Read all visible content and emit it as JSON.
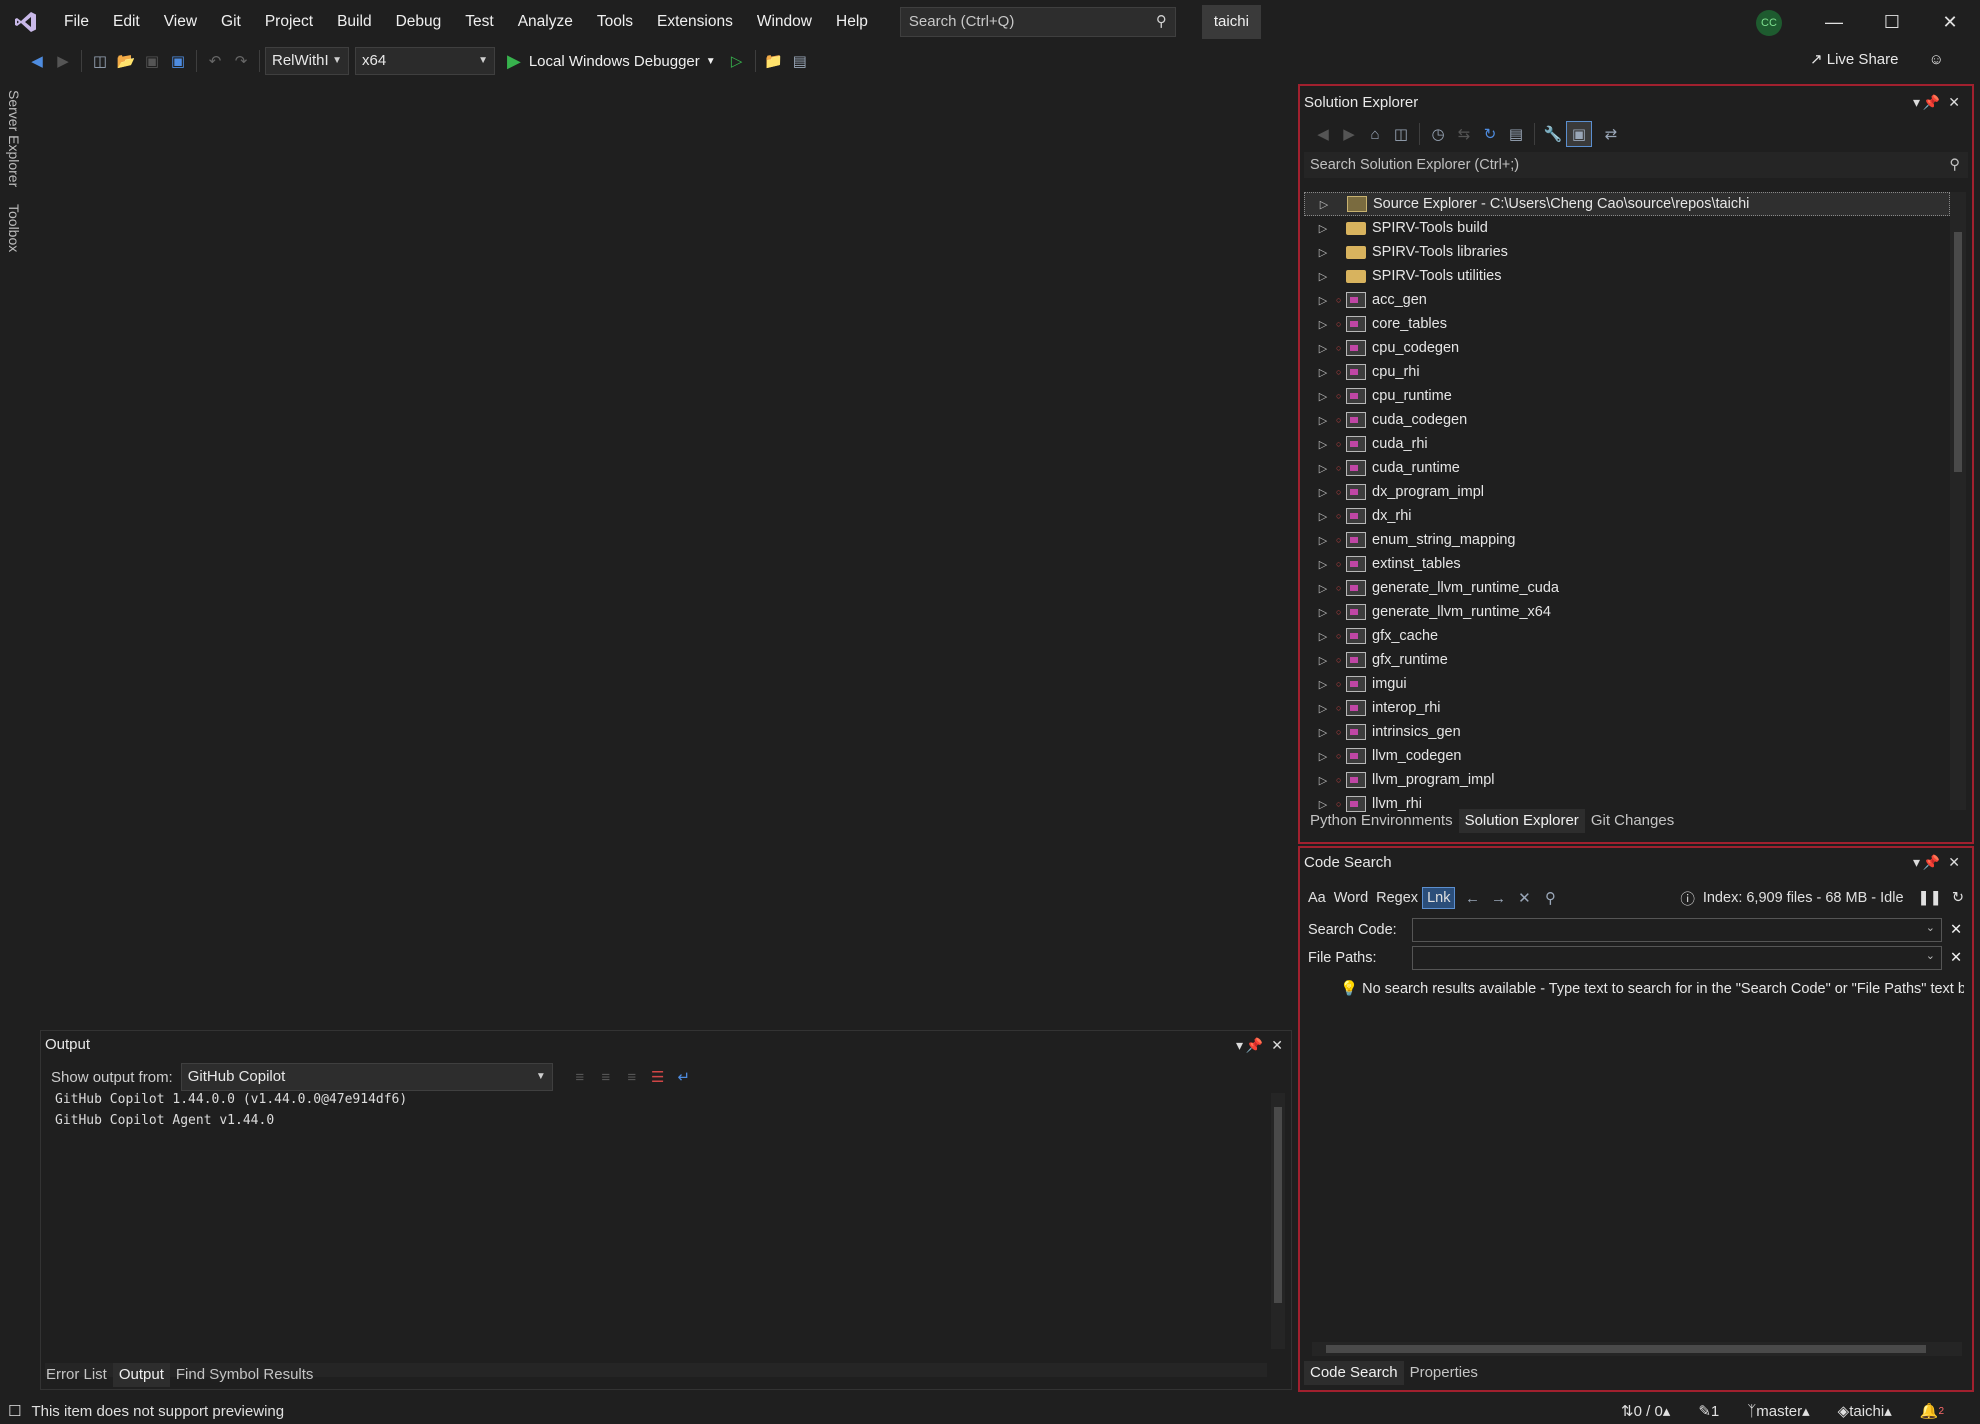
{
  "title_bar": {
    "menu": [
      "File",
      "Edit",
      "View",
      "Git",
      "Project",
      "Build",
      "Debug",
      "Test",
      "Analyze",
      "Tools",
      "Extensions",
      "Window",
      "Help"
    ],
    "search_placeholder": "Search (Ctrl+Q)",
    "solution_name": "taichi",
    "account_initials": "CC"
  },
  "toolbar": {
    "configuration": "RelWithI",
    "platform": "x64",
    "run_label": "Local Windows Debugger",
    "live_share": "Live Share"
  },
  "sidebar": {
    "tabs": [
      "Server Explorer",
      "Toolbox"
    ]
  },
  "solution_explorer": {
    "title": "Solution Explorer",
    "search_placeholder": "Search Solution Explorer (Ctrl+;)",
    "items": [
      {
        "label": "Source Explorer - C:\\Users\\Cheng Cao\\source\\repos\\taichi",
        "kind": "source"
      },
      {
        "label": "SPIRV-Tools build",
        "kind": "folder"
      },
      {
        "label": "SPIRV-Tools libraries",
        "kind": "folder"
      },
      {
        "label": "SPIRV-Tools utilities",
        "kind": "folder"
      },
      {
        "label": "acc_gen",
        "kind": "project"
      },
      {
        "label": "core_tables",
        "kind": "project"
      },
      {
        "label": "cpu_codegen",
        "kind": "project"
      },
      {
        "label": "cpu_rhi",
        "kind": "project"
      },
      {
        "label": "cpu_runtime",
        "kind": "project"
      },
      {
        "label": "cuda_codegen",
        "kind": "project"
      },
      {
        "label": "cuda_rhi",
        "kind": "project"
      },
      {
        "label": "cuda_runtime",
        "kind": "project"
      },
      {
        "label": "dx_program_impl",
        "kind": "project"
      },
      {
        "label": "dx_rhi",
        "kind": "project"
      },
      {
        "label": "enum_string_mapping",
        "kind": "project"
      },
      {
        "label": "extinst_tables",
        "kind": "project"
      },
      {
        "label": "generate_llvm_runtime_cuda",
        "kind": "project"
      },
      {
        "label": "generate_llvm_runtime_x64",
        "kind": "project"
      },
      {
        "label": "gfx_cache",
        "kind": "project"
      },
      {
        "label": "gfx_runtime",
        "kind": "project"
      },
      {
        "label": "imgui",
        "kind": "project"
      },
      {
        "label": "interop_rhi",
        "kind": "project"
      },
      {
        "label": "intrinsics_gen",
        "kind": "project"
      },
      {
        "label": "llvm_codegen",
        "kind": "project"
      },
      {
        "label": "llvm_program_impl",
        "kind": "project"
      },
      {
        "label": "llvm_rhi",
        "kind": "project"
      }
    ],
    "tabs": [
      "Python Environments",
      "Solution Explorer",
      "Git Changes"
    ]
  },
  "code_search": {
    "title": "Code Search",
    "options": [
      "Aa",
      "Word",
      "Regex",
      "Lnk"
    ],
    "index_status": "Index: 6,909 files - 68 MB - Idle",
    "search_code_label": "Search Code:",
    "file_paths_label": "File Paths:",
    "message": "No search results available - Type text to search for in the \"Search Code\" or \"File Paths\" text b",
    "tabs": [
      "Code Search",
      "Properties"
    ]
  },
  "output": {
    "title": "Output",
    "show_from_label": "Show output from:",
    "source": "GitHub Copilot",
    "lines": [
      "GitHub Copilot 1.44.0.0 (v1.44.0.0@47e914df6)",
      "GitHub Copilot Agent v1.44.0"
    ],
    "tabs": [
      "Error List",
      "Output",
      "Find Symbol Results"
    ]
  },
  "status_bar": {
    "message": "This item does not support previewing",
    "changes": "0 / 0",
    "edits": "1",
    "branch": "master",
    "repo": "taichi",
    "notifications": "2"
  },
  "colors": {
    "frame_highlight": "#a1202e",
    "background": "#1f1f1f",
    "accent": "#37b24d"
  }
}
